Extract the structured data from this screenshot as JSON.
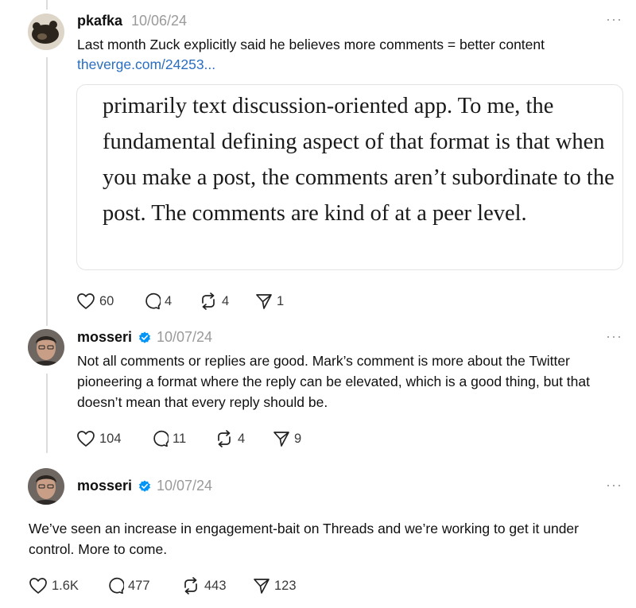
{
  "posts": [
    {
      "username": "pkafka",
      "date": "10/06/24",
      "more": "···",
      "text": "Last month Zuck explicitly said he believes more comments = better content",
      "link": "theverge.com/24253...",
      "quote": "primarily text discussion-oriented app. To me, the fundamental defining aspect of that format is that when you make a post, the comments aren’t subordinate to the post. The comments are kind of at a peer level.",
      "likes": "60",
      "replies": "4",
      "reposts": "4",
      "shares": "1"
    },
    {
      "username": "mosseri",
      "date": "10/07/24",
      "more": "···",
      "text": "Not all comments or replies are good. Mark’s comment is more about the Twitter pioneering a format where the reply can be elevated, which is a good thing, but that doesn’t mean that every reply should be.",
      "likes": "104",
      "replies": "11",
      "reposts": "4",
      "shares": "9"
    },
    {
      "username": "mosseri",
      "date": "10/07/24",
      "more": "···",
      "text": "We’ve seen an increase in engagement-bait on Threads and we’re working to get it under control. More to come.",
      "likes": "1.6K",
      "replies": "477",
      "reposts": "443",
      "shares": "123"
    }
  ],
  "colors": {
    "link": "#2a6ec0",
    "verified": "#0095f6",
    "muted": "#9a9a9a"
  },
  "icons": [
    "heart-icon",
    "comment-icon",
    "repost-icon",
    "share-icon",
    "verified-badge-icon",
    "more-icon"
  ]
}
